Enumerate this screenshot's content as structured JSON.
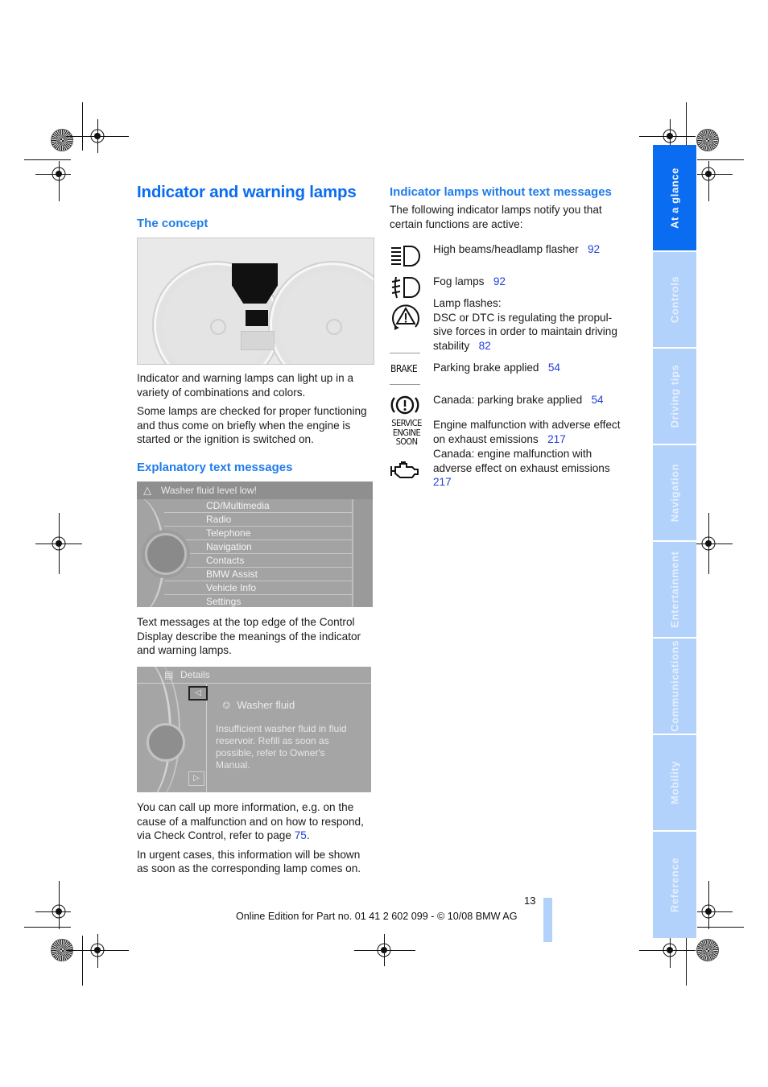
{
  "page": {
    "title": "Indicator and warning lamps",
    "page_number": "13",
    "footer": "Online Edition for Part no. 01 41 2 602 099 - © 10/08 BMW AG"
  },
  "left": {
    "concept_heading": "The concept",
    "concept_paragraphs": [
      "Indicator and warning lamps can light up in a variety of combinations and colors.",
      "Some lamps are checked for proper functioning and thus come on briefly when the engine is started or the ignition is switched on."
    ],
    "explanatory_heading": "Explanatory text messages",
    "menu_screen": {
      "warning": "Washer fluid level low!",
      "warning_icon": "warning-triangle-icon",
      "items": [
        "CD/Multimedia",
        "Radio",
        "Telephone",
        "Navigation",
        "Contacts",
        "BMW Assist",
        "Vehicle Info",
        "Settings"
      ]
    },
    "explanatory_paragraph": "Text messages at the top edge of the Control Display describe the meanings of the indicator and warning lamps.",
    "detail_screen": {
      "header": "Details",
      "title": "Washer fluid",
      "body": "Insufficient washer fluid in fluid reservoir. Refill as soon as possible, refer to Owner's Manual."
    },
    "more_info": {
      "text": "You can call up more information, e.g. on the cause of a malfunction and on how to respond, via Check Control, refer to page ",
      "page_ref": "75",
      "suffix": "."
    },
    "urgent_paragraph": "In urgent cases, this information will be shown as soon as the corresponding lamp comes on."
  },
  "right": {
    "heading": "Indicator lamps without text messages",
    "intro": "The following indicator lamps notify you that certain functions are active:",
    "lamps": [
      {
        "icon": "high-beam-icon",
        "text": "High beams/headlamp flasher",
        "page": "92"
      },
      {
        "icon": "fog-lamp-icon",
        "text": "Fog lamps",
        "page": "92"
      },
      {
        "icon": "dsc-warning-icon",
        "text": "Lamp flashes:\nDSC or DTC is regulating the propulsive forces in order to maintain driving stability",
        "line1": "Lamp flashes:",
        "line2": "DSC or DTC is regulating the propul-sive forces in order to maintain driving stability",
        "page": "82"
      },
      {
        "icon": "brake-text-icon",
        "icon_label": "BRAKE",
        "text": "Parking brake applied",
        "page": "54"
      },
      {
        "icon": "parking-brake-canada-icon",
        "text": "Canada: parking brake applied",
        "page": "54"
      },
      {
        "icon": "service-engine-soon-icon",
        "icon_label": "SERVICE ENGINE SOON",
        "text": "Engine malfunction with adverse effect on exhaust emissions",
        "page": "217"
      },
      {
        "icon": "check-engine-icon",
        "text": "Canada: engine malfunction with adverse effect on exhaust emissions",
        "page": "217"
      }
    ]
  },
  "sidenav": {
    "tabs": [
      {
        "label": "At a glance",
        "active": true
      },
      {
        "label": "Controls",
        "active": false
      },
      {
        "label": "Driving tips",
        "active": false
      },
      {
        "label": "Navigation",
        "active": false
      },
      {
        "label": "Entertainment",
        "active": false
      },
      {
        "label": "Communications",
        "active": false
      },
      {
        "label": "Mobility",
        "active": false
      },
      {
        "label": "Reference",
        "active": false
      }
    ]
  },
  "colors": {
    "heading_blue": "#0a6cf0",
    "link_blue": "#1f3fd8",
    "tab_active": "#0a6cf0",
    "tab_inactive": "#b2d2fb"
  }
}
